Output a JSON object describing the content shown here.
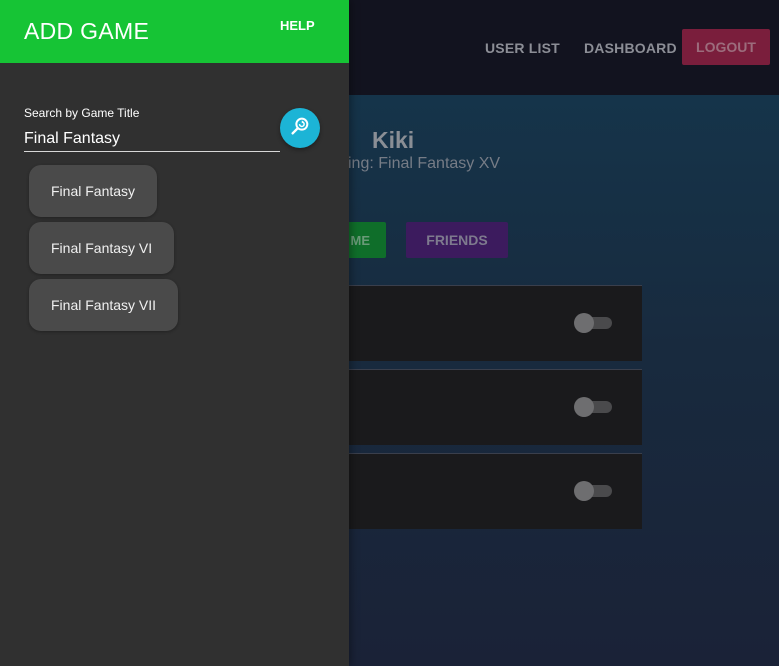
{
  "nav": {
    "user_list": "USER LIST",
    "dashboard": "DASHBOARD",
    "logout": "LOGOUT"
  },
  "profile": {
    "name": "Kiki",
    "now_playing": "ying: Final Fantasy XV",
    "buttons": {
      "game": "ME",
      "friends": "FRIENDS"
    }
  },
  "game_rows": [
    {
      "toggle_on": false
    },
    {
      "toggle_on": false
    },
    {
      "toggle_on": false
    }
  ],
  "drawer": {
    "title": "ADD GAME",
    "help": "HELP",
    "search": {
      "label": "Search by Game Title",
      "value": "Final Fantasy",
      "button_icon": "search-refresh-icon"
    },
    "results": [
      {
        "label": "Final Fantasy"
      },
      {
        "label": "Final Fantasy VI"
      },
      {
        "label": "Final Fantasy VII"
      }
    ]
  },
  "colors": {
    "drawer_header": "#16c435",
    "drawer_bg": "#303030",
    "search_button": "#1cb4d6",
    "logout_button": "#7a1e3c",
    "friends_button": "#3c1b5e",
    "game_button": "#0f6e2a"
  }
}
